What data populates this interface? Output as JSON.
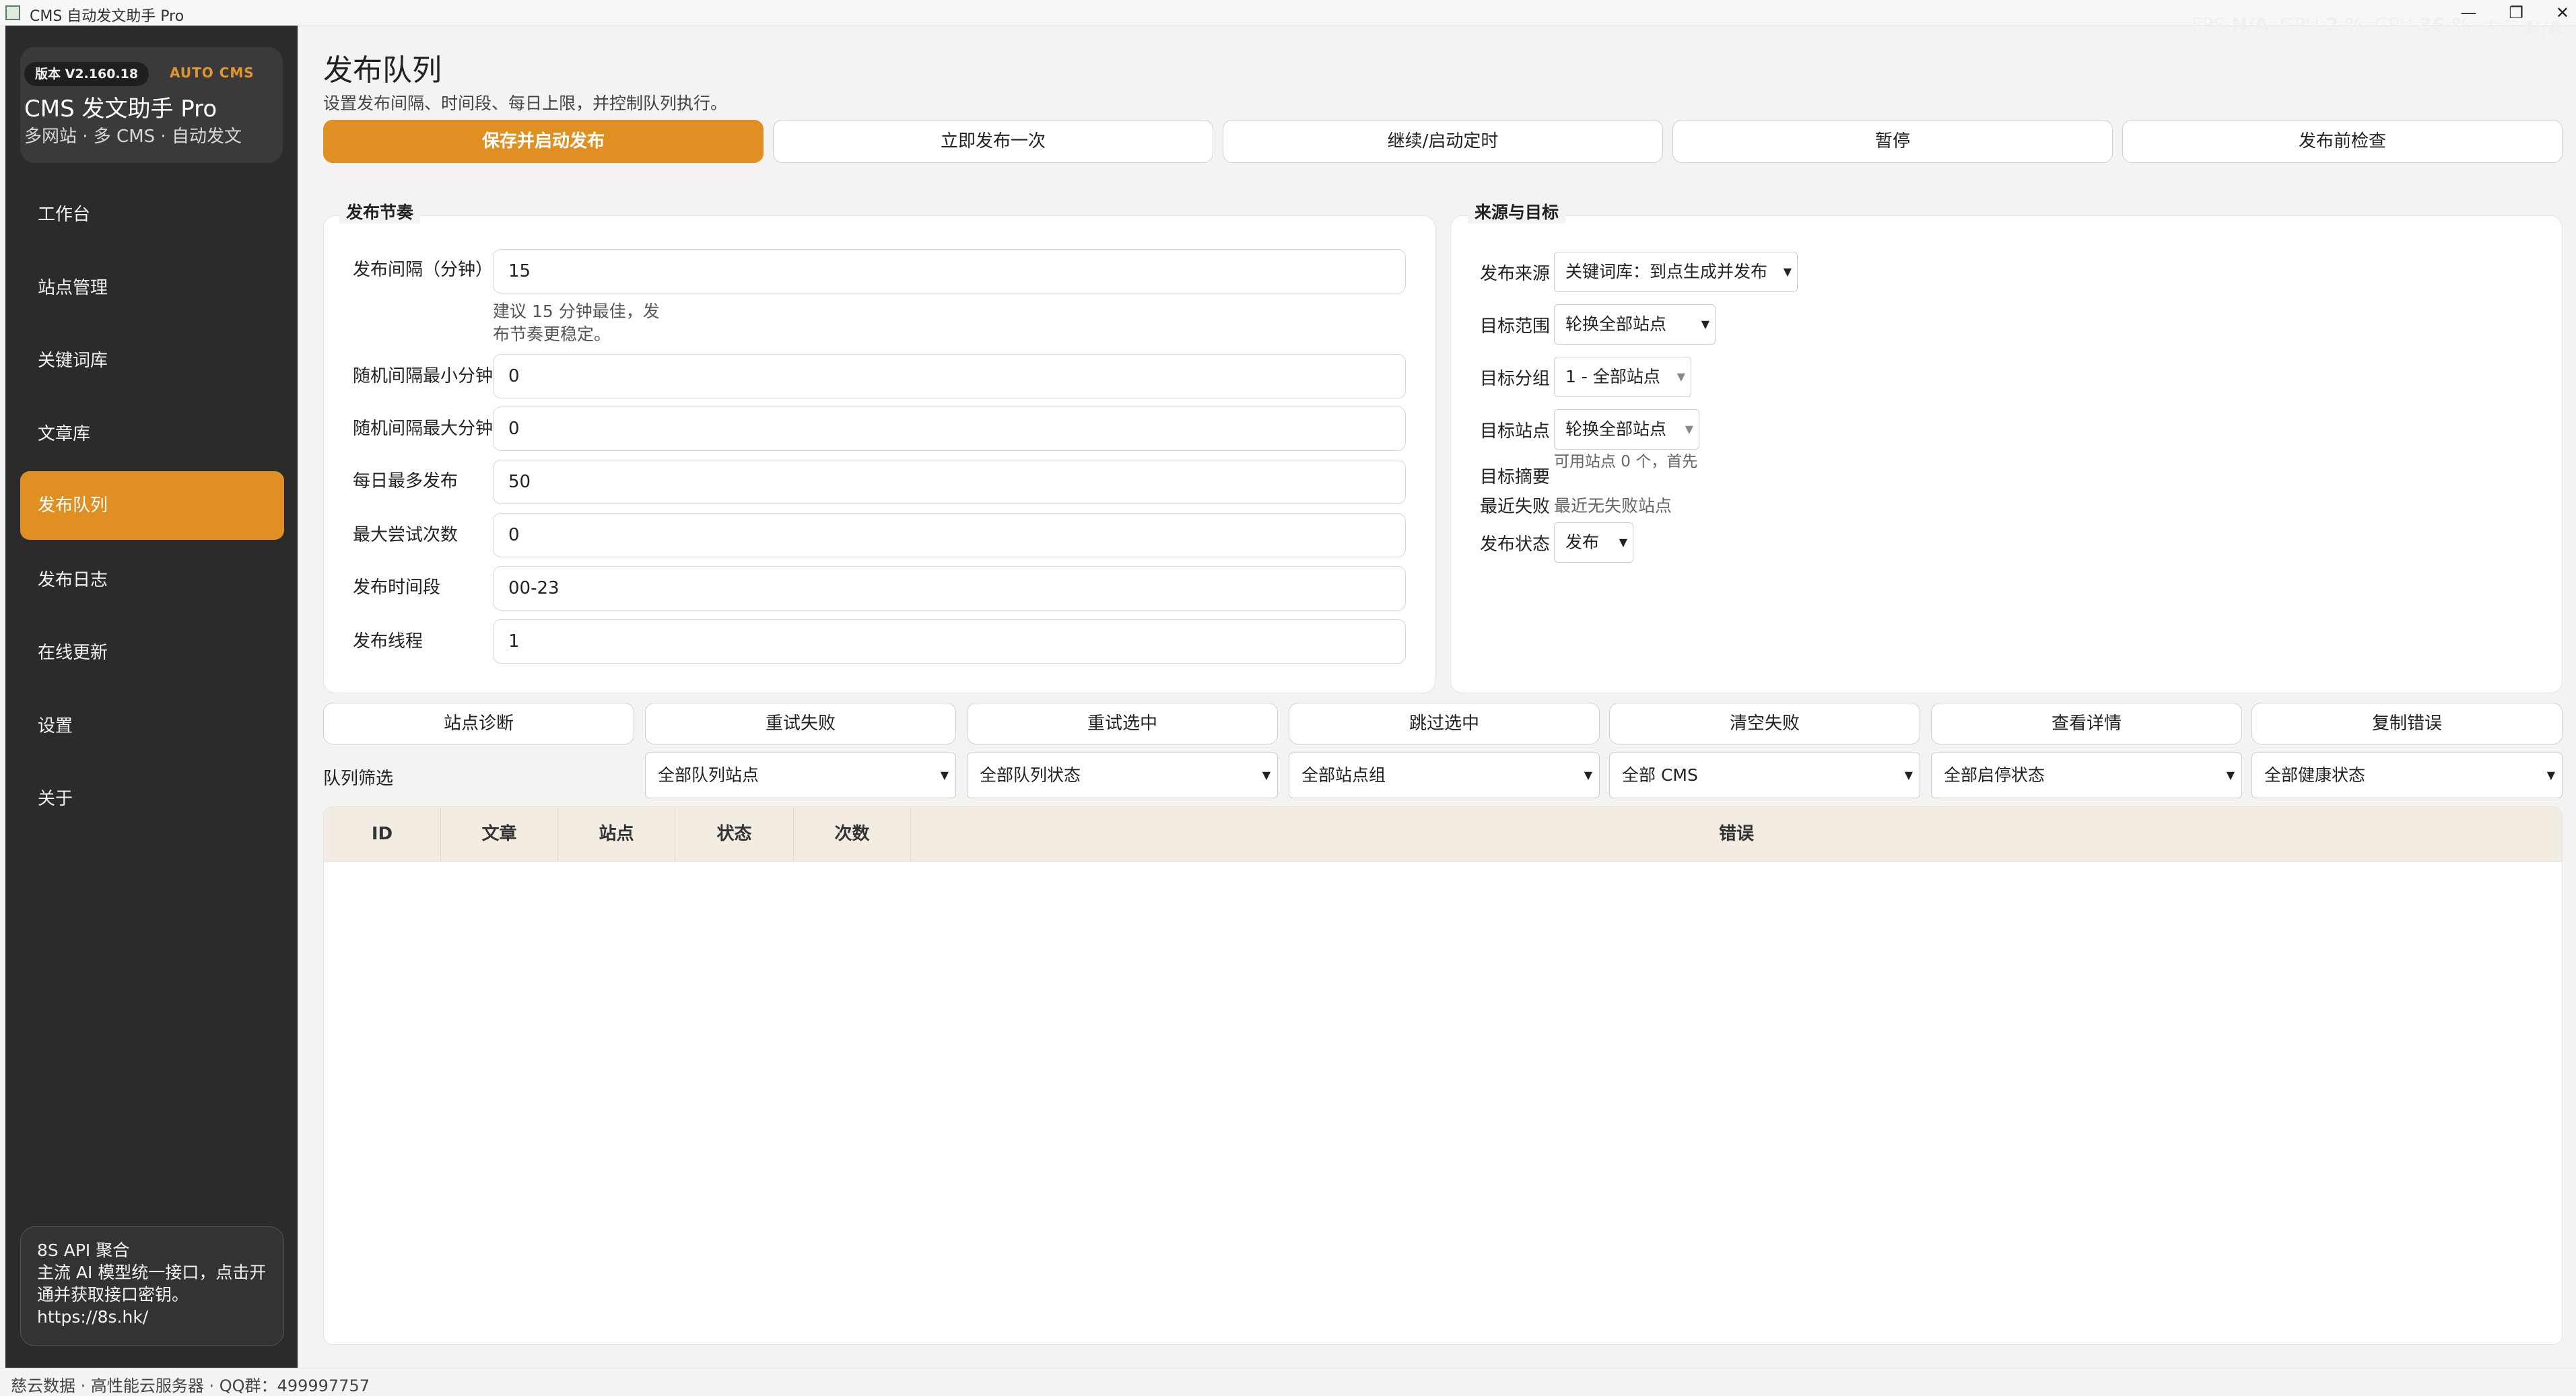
{
  "window": {
    "title": "CMS 自动发文助手 Pro",
    "controls": [
      "—",
      "❐",
      "✕"
    ]
  },
  "perf": [
    {
      "label": "FPS",
      "value": "N/A"
    },
    {
      "label": "GPU",
      "value": "2 %"
    },
    {
      "label": "CPU",
      "value": "36 %"
    },
    {
      "label": "内存",
      "value": "N/A"
    }
  ],
  "brand": {
    "version": "版本 V2.160.18",
    "tag": "AUTO CMS",
    "title": "CMS 发文助手 Pro",
    "subtitle": "多网站 · 多 CMS · 自动发文"
  },
  "nav": {
    "items": [
      {
        "label": "工作台"
      },
      {
        "label": "站点管理"
      },
      {
        "label": "关键词库"
      },
      {
        "label": "文章库"
      },
      {
        "label": "发布队列",
        "active": true
      },
      {
        "label": "发布日志"
      },
      {
        "label": "在线更新"
      },
      {
        "label": "设置"
      },
      {
        "label": "关于"
      }
    ]
  },
  "promo": {
    "title": "8S API 聚合",
    "text": "主流 AI 模型统一接口，点击开通并获取接口密钥。",
    "url": "https://8s.hk/"
  },
  "header": {
    "title": "发布队列",
    "subtitle": "设置发布间隔、时间段、每日上限，并控制队列执行。"
  },
  "toolbar": {
    "buttons": [
      "保存并启动发布",
      "立即发布一次",
      "继续/启动定时",
      "暂停",
      "发布前检查"
    ]
  },
  "rhythm": {
    "title": "发布节奏",
    "interval_label": "发布间隔（分钟）",
    "interval_value": "15",
    "interval_hint": "建议 15 分钟最佳，发布节奏更稳定。",
    "rand_min_label": "随机间隔最小分钟",
    "rand_min_value": "0",
    "rand_max_label": "随机间隔最大分钟",
    "rand_max_value": "0",
    "daily_label": "每日最多发布",
    "daily_value": "50",
    "retry_label": "最大尝试次数",
    "retry_value": "0",
    "hours_label": "发布时间段",
    "hours_value": "00-23",
    "threads_label": "发布线程",
    "threads_value": "1"
  },
  "target": {
    "title": "来源与目标",
    "source_label": "发布来源",
    "source_value": "关键词库：到点生成并发布",
    "scope_label": "目标范围",
    "scope_value": "轮换全部站点",
    "group_label": "目标分组",
    "group_value": "1 - 全部站点",
    "site_label": "目标站点",
    "site_value": "轮换全部站点",
    "summary_label": "目标摘要",
    "summary_value": "可用站点 0 个，首先",
    "recent_fail_label": "最近失败",
    "recent_fail_value": "最近无失败站点",
    "status_label": "发布状态",
    "status_value": "发布"
  },
  "actions": [
    "站点诊断",
    "重试失败",
    "重试选中",
    "跳过选中",
    "清空失败",
    "查看详情",
    "复制错误"
  ],
  "filters": {
    "label": "队列筛选",
    "options": [
      "全部队列站点",
      "全部队列状态",
      "全部站点组",
      "全部 CMS",
      "全部启停状态",
      "全部健康状态"
    ]
  },
  "table": {
    "columns": [
      "ID",
      "文章",
      "站点",
      "状态",
      "次数",
      "错误"
    ],
    "rows": []
  },
  "footer": {
    "text": "慈云数据 · 高性能云服务器 · QQ群：499997757"
  },
  "colors": {
    "accent": "#e08f23",
    "sidebar": "#2b2b2b",
    "table_header": "#f3ece3"
  }
}
